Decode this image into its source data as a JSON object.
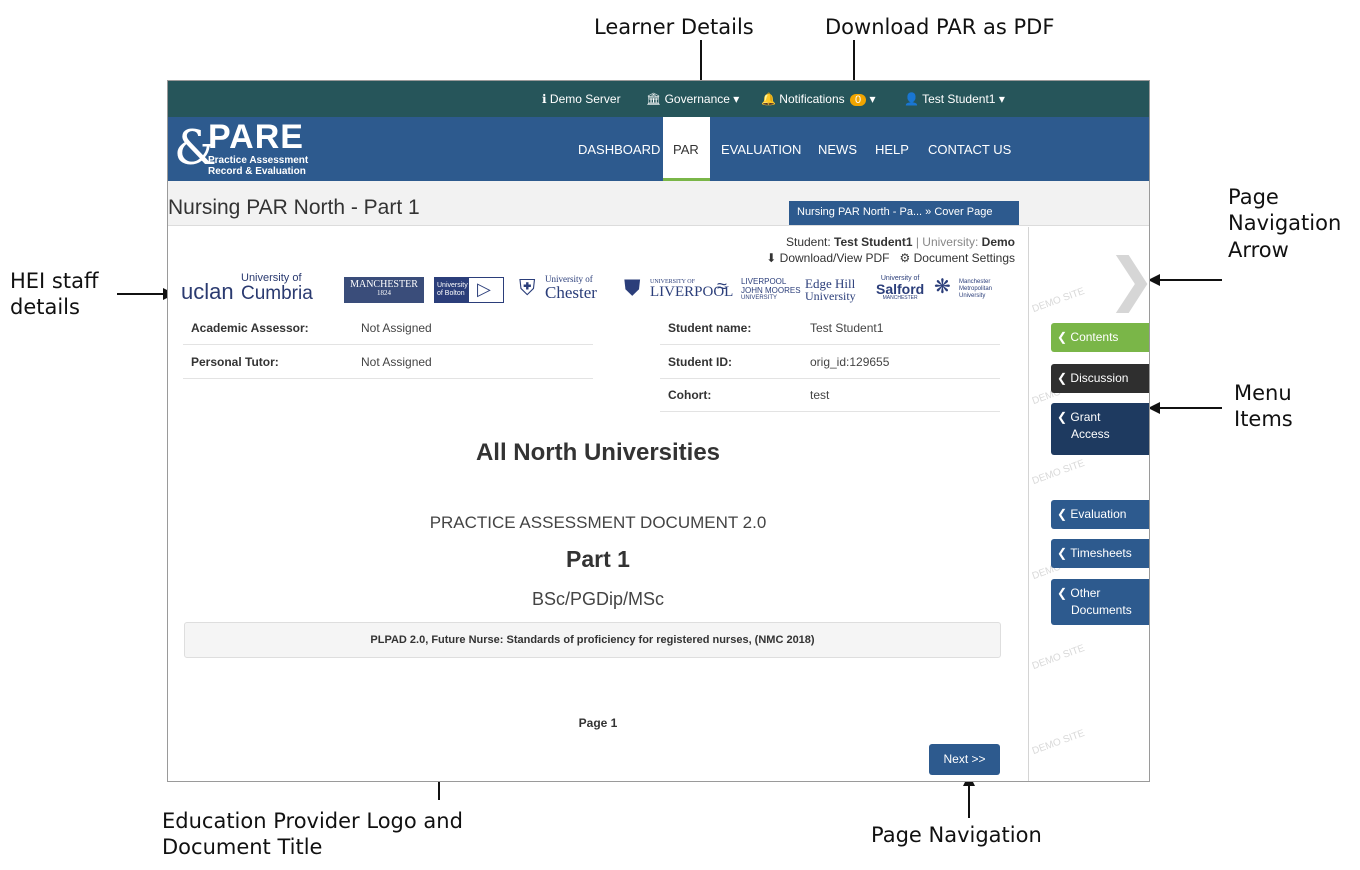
{
  "annotations": {
    "learner_details": "Learner Details",
    "download_par": "Download PAR as PDF",
    "page_nav_arrow_1": "Page",
    "page_nav_arrow_2": "Navigation",
    "page_nav_arrow_3": "Arrow",
    "hei_staff_1": "HEI staff",
    "hei_staff_2": "details",
    "menu_items_1": "Menu",
    "menu_items_2": "Items",
    "edu_provider_1": "Education Provider Logo and",
    "edu_provider_2": "Document Title",
    "page_navigation": "Page Navigation"
  },
  "topbar": {
    "server": "Demo Server",
    "governance": "Governance",
    "notifications": "Notifications",
    "notification_count": "0",
    "user": "Test Student1"
  },
  "logo": {
    "title": "PARE",
    "line1": "Practice Assessment",
    "line2": "Record & Evaluation"
  },
  "nav": {
    "dashboard": "DASHBOARD",
    "par": "PAR",
    "evaluation": "EVALUATION",
    "news": "NEWS",
    "help": "HELP",
    "contact": "CONTACT US"
  },
  "page": {
    "title": "Nursing PAR North - Part 1",
    "breadcrumb": "Nursing PAR North - Pa... » Cover Page"
  },
  "student_line": {
    "student_label": "Student:",
    "student_name": "Test Student1",
    "university_label": "| University:",
    "university_name": "Demo",
    "download": "Download/View PDF",
    "settings": "Document Settings"
  },
  "universities": {
    "uclan": "uclan",
    "cumbria_1": "University of",
    "cumbria_2": "Cumbria",
    "manchester_1": "MANCHESTER",
    "manchester_2": "1824",
    "bolton_1": "University",
    "bolton_2": "of Bolton",
    "chester_1": "University of",
    "chester_2": "Chester",
    "liverpool_1": "UNIVERSITY OF",
    "liverpool_2": "LIVERPOOL",
    "ljmu_1": "LIVERPOOL",
    "ljmu_2": "JOHN MOORES",
    "ljmu_3": "UNIVERSITY",
    "edgehill_1": "Edge Hill",
    "edgehill_2": "University",
    "salford_1": "University of",
    "salford_2": "Salford",
    "salford_3": "MANCHESTER",
    "mmu_1": "Manchester",
    "mmu_2": "Metropolitan",
    "mmu_3": "University"
  },
  "staff": [
    {
      "label": "Academic Assessor:",
      "value": "Not Assigned"
    },
    {
      "label": "Personal Tutor:",
      "value": "Not Assigned"
    }
  ],
  "learner": [
    {
      "label": "Student name:",
      "value": "Test Student1"
    },
    {
      "label": "Student ID:",
      "value": "orig_id:129655"
    },
    {
      "label": "Cohort:",
      "value": "test"
    }
  ],
  "document": {
    "heading": "All North Universities",
    "subheading": "PRACTICE ASSESSMENT DOCUMENT 2.0",
    "part": "Part 1",
    "degree": "BSc/PGDip/MSc",
    "standard": "PLPAD 2.0, Future Nurse: Standards of proficiency for registered nurses, (NMC 2018)",
    "page_label": "Page 1",
    "next": "Next >>"
  },
  "side_menu": {
    "contents": "Contents",
    "discussion": "Discussion",
    "grant_1": "Grant",
    "grant_2": "Access",
    "evaluation": "Evaluation",
    "timesheets": "Timesheets",
    "other_1": "Other",
    "other_2": "Documents",
    "watermark": "DEMO SITE"
  },
  "colors": {
    "topbar": "#26555a",
    "navbar": "#2d5a8e",
    "contents_tab": "#7ab648",
    "discussion_tab": "#2f2f2f",
    "grant_tab": "#1e3a60",
    "badge": "#f0a500"
  }
}
